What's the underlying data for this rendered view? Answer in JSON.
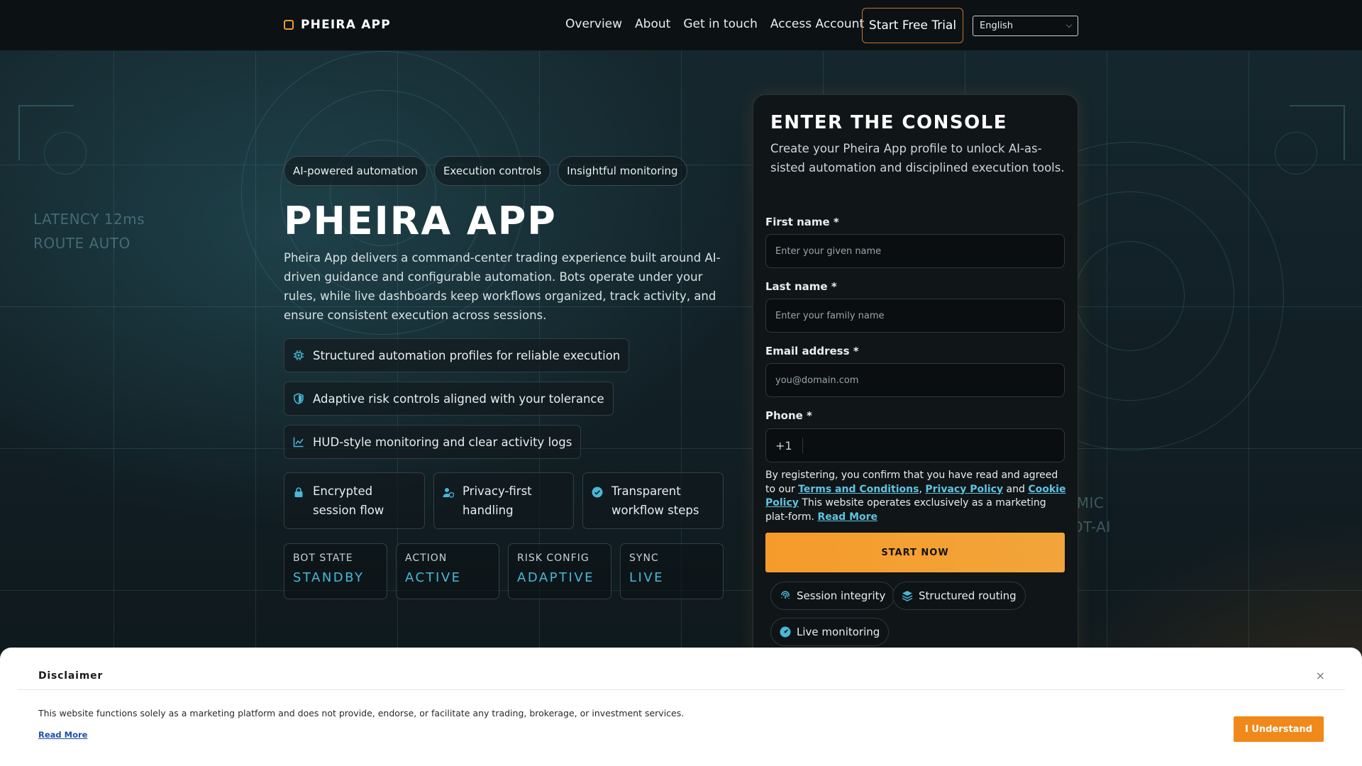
{
  "header": {
    "brand": "PHEIRA APP",
    "nav": [
      "Overview",
      "About",
      "Get in touch",
      "Access Account"
    ],
    "trial_button": "Start Free Trial",
    "language": "English"
  },
  "background": {
    "left_lines": [
      "LATENCY 12ms",
      "ROUTE AUTO"
    ],
    "right_lines": [
      "AP DYNAMIC",
      "MODE BOT-AI"
    ]
  },
  "hero": {
    "tags": [
      "AI-powered automation",
      "Execution controls",
      "Insightful monitoring"
    ],
    "title": "PHEIRA APP",
    "description": "Pheira App delivers a command-center trading experience built around AI-driven guidance and configurable automation. Bots operate under your rules, while live dashboards keep workflows organized, track activity, and ensure consistent execution across sessions.",
    "features": [
      {
        "icon": "chip-icon",
        "text": "Structured automation profiles for reliable execution"
      },
      {
        "icon": "shield-icon",
        "text": "Adaptive risk controls aligned with your tolerance"
      },
      {
        "icon": "chart-line-icon",
        "text": "HUD-style monitoring and clear activity logs"
      }
    ],
    "mini_cards": [
      {
        "icon": "lock-icon",
        "text": "Encrypted session flow"
      },
      {
        "icon": "user-shield-icon",
        "text": "Privacy-first handling"
      },
      {
        "icon": "check-circle-icon",
        "text": "Transparent workflow steps"
      }
    ],
    "stats": [
      {
        "label": "BOT STATE",
        "value": "STANDBY"
      },
      {
        "label": "ACTION",
        "value": "ACTIVE"
      },
      {
        "label": "RISK CONFIG",
        "value": "ADAPTIVE"
      },
      {
        "label": "SYNC",
        "value": "LIVE"
      }
    ]
  },
  "console": {
    "title": "ENTER THE CONSOLE",
    "subtitle": "Create your Pheira App profile to unlock AI-as-sisted automation and disciplined execution tools.",
    "fields": {
      "first_name_label": "First name *",
      "first_name_placeholder": "Enter your given name",
      "last_name_label": "Last name *",
      "last_name_placeholder": "Enter your family name",
      "email_label": "Email address *",
      "email_placeholder": "you@domain.com",
      "phone_label": "Phone *",
      "phone_code": "+1"
    },
    "consent": {
      "pre": "By registering, you confirm that you have read and agreed to our ",
      "terms": "Terms and Conditions",
      "sep1": ", ",
      "privacy": "Privacy Policy",
      "sep2": " and ",
      "cookie": "Cookie Policy",
      "post": " This website operates exclusively as a marketing plat-form. ",
      "read_more": "Read More"
    },
    "submit": "START NOW",
    "chips": [
      {
        "icon": "fingerprint-icon",
        "text": "Session integrity"
      },
      {
        "icon": "layers-icon",
        "text": "Structured routing"
      },
      {
        "icon": "gauge-icon",
        "text": "Live monitoring"
      }
    ]
  },
  "disclaimer": {
    "title": "Disclaimer",
    "close": "×",
    "text": "This website functions solely as a marketing platform and does not provide, endorse, or facilitate any trading, brokerage, or investment services.",
    "read_more": "Read More",
    "accept": "I Understand"
  },
  "colors": {
    "accent": "#f29a2e",
    "cyan": "#49b8d6",
    "link": "#5ec4e0"
  }
}
